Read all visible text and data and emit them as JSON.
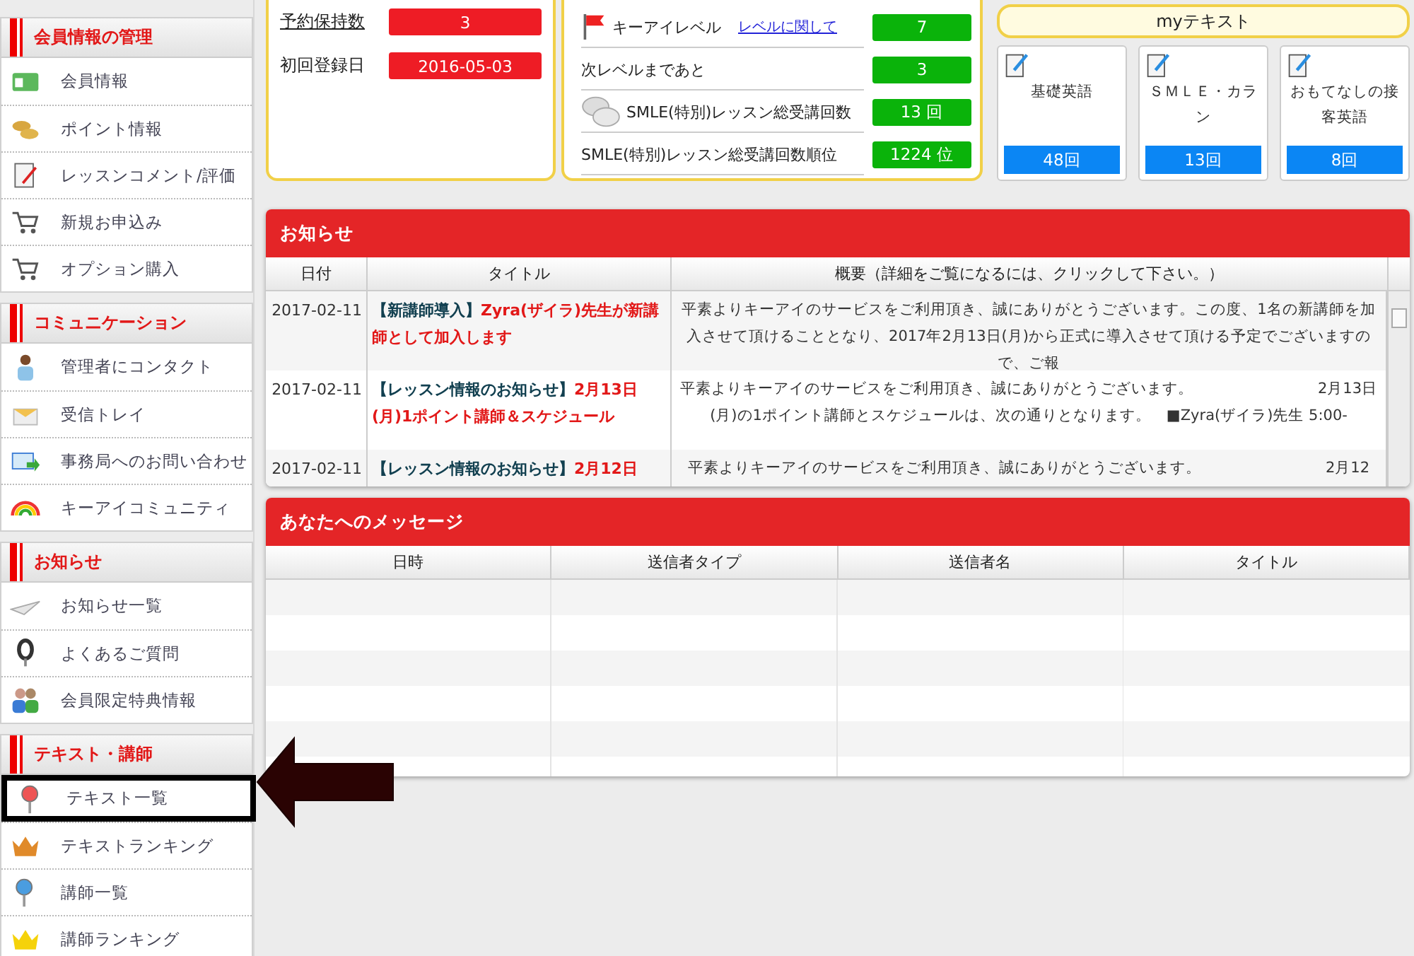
{
  "sidebar": {
    "sections": [
      {
        "title": "会員情報の管理",
        "items": [
          {
            "label": "会員情報",
            "highlighted": false
          },
          {
            "label": "ポイント情報",
            "highlighted": false
          },
          {
            "label": "レッスンコメント/評価",
            "highlighted": false
          },
          {
            "label": "新規お申込み",
            "highlighted": false
          },
          {
            "label": "オプション購入",
            "highlighted": false
          }
        ]
      },
      {
        "title": "コミュニケーション",
        "items": [
          {
            "label": "管理者にコンタクト",
            "highlighted": false
          },
          {
            "label": "受信トレイ",
            "highlighted": false
          },
          {
            "label": "事務局へのお問い合わせ",
            "highlighted": false
          },
          {
            "label": "キーアイコミュニティ",
            "highlighted": false
          }
        ]
      },
      {
        "title": "お知らせ",
        "items": [
          {
            "label": "お知らせ一覧",
            "highlighted": false
          },
          {
            "label": "よくあるご質問",
            "highlighted": false
          },
          {
            "label": "会員限定特典情報",
            "highlighted": false
          }
        ]
      },
      {
        "title": "テキスト・講師",
        "items": [
          {
            "label": "テキスト一覧",
            "highlighted": true
          },
          {
            "label": "テキストランキング",
            "highlighted": false
          },
          {
            "label": "講師一覧",
            "highlighted": false
          },
          {
            "label": "講師ランキング",
            "highlighted": false
          }
        ]
      }
    ]
  },
  "account_card": {
    "rows": [
      {
        "label": "予約保持数",
        "kind": "link",
        "value": "3"
      },
      {
        "label": "初回登録日",
        "kind": "plain",
        "value": "2016-05-03"
      }
    ]
  },
  "level_card": {
    "rows": [
      {
        "label": "キーアイレベル",
        "kind": "flag",
        "link": "レベルに関して",
        "value": "7"
      },
      {
        "label": "次レベルまであと",
        "kind": "plain",
        "value": "3"
      },
      {
        "label": "SMLE(特別)レッスン総受講回数",
        "kind": "chat",
        "value": "13 回"
      },
      {
        "label": "SMLE(特別)レッスン総受講回数順位",
        "kind": "plain",
        "value": "1224 位"
      }
    ]
  },
  "my_texts": {
    "title": "myテキスト",
    "items": [
      {
        "name": "基礎英語",
        "count": "48回"
      },
      {
        "name": "ＳＭＬＥ・カラン",
        "count": "13回"
      },
      {
        "name": "おもてなしの接客英語",
        "count": "8回"
      }
    ]
  },
  "notices": {
    "title": "お知らせ",
    "columns": [
      "日付",
      "タイトル",
      "概要（詳細をご覧になるには、クリックして下さい。）"
    ],
    "rows": [
      {
        "date": "2017-02-11",
        "tag": "【新講師導入】",
        "headline": "Zyra(ザイラ)先生が新講師として加入します",
        "summary": "平素よりキーアイのサービスをご利用頂き、誠にありがとうございます。この度、1名の新講師を加入させて頂けることとなり、2017年2月13日(月)から正式に導入させて頂ける予定でございますので、ご報"
      },
      {
        "date": "2017-02-11",
        "tag": "【レッスン情報のお知らせ】",
        "headline": "2月13日(月)1ポイント講師＆スケジュール",
        "summary": "平素よりキーアイのサービスをご利用頂き、誠にありがとうございます。　　　　　　　　2月13日(月)の1ポイント講師とスケジュールは、次の通りとなります。　■Zyra(ザイラ)先生 5:00-"
      },
      {
        "date": "2017-02-11",
        "tag": "【レッスン情報のお知らせ】",
        "headline": "2月12日",
        "summary": "平素よりキーアイのサービスをご利用頂き、誠にありがとうございます。　　　　　　　　2月12"
      }
    ]
  },
  "messages": {
    "title": "あなたへのメッセージ",
    "columns": [
      "日時",
      "送信者タイプ",
      "送信者名",
      "タイトル"
    ]
  }
}
